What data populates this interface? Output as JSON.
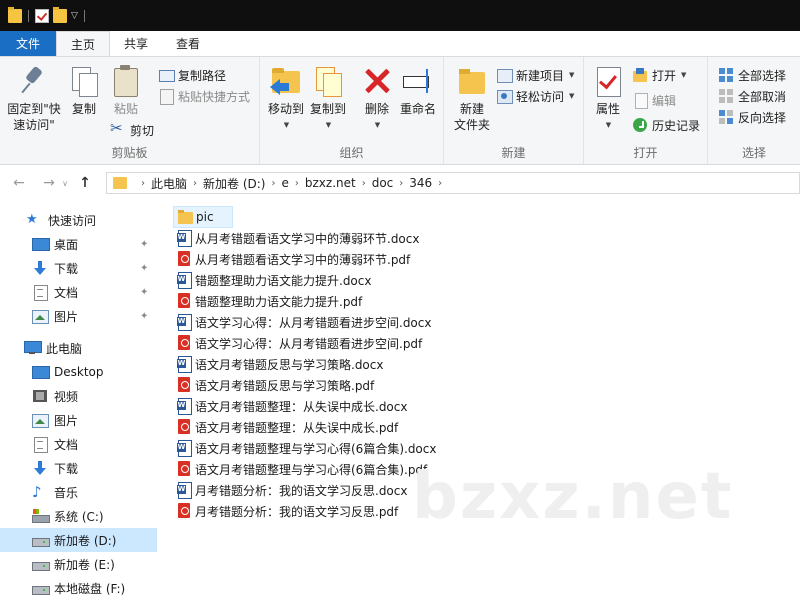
{
  "ribbon_tabs": [
    "文件",
    "主页",
    "共享",
    "查看"
  ],
  "clipboard": {
    "pin_label_1": "固定到\"快",
    "pin_label_2": "速访问\"",
    "copy": "复制",
    "paste": "粘贴",
    "copy_path": "复制路径",
    "paste_shortcut": "粘贴快捷方式",
    "cut": "剪切",
    "group": "剪贴板"
  },
  "organize": {
    "move_to": "移动到",
    "copy_to": "复制到",
    "delete": "删除",
    "rename": "重命名",
    "group": "组织"
  },
  "new": {
    "new_folder_1": "新建",
    "new_folder_2": "文件夹",
    "new_item": "新建项目",
    "easy_access": "轻松访问",
    "group": "新建"
  },
  "open": {
    "properties": "属性",
    "open": "打开",
    "edit": "编辑",
    "history": "历史记录",
    "group": "打开"
  },
  "select": {
    "select_all": "全部选择",
    "select_none": "全部取消",
    "invert": "反向选择",
    "group": "选择"
  },
  "address": {
    "segments": [
      "此电脑",
      "新加卷 (D:)",
      "e",
      "bzxz.net",
      "doc",
      "346"
    ]
  },
  "sidebar": {
    "items": [
      {
        "label": "快速访问",
        "icon": "star-icon"
      },
      {
        "label": "桌面",
        "icon": "desktop-icon",
        "pinned": true
      },
      {
        "label": "下载",
        "icon": "download-icon",
        "pinned": true
      },
      {
        "label": "文档",
        "icon": "document-icon",
        "pinned": true
      },
      {
        "label": "图片",
        "icon": "picture-icon",
        "pinned": true
      },
      {
        "label": "此电脑",
        "icon": "computer-icon"
      },
      {
        "label": "Desktop",
        "icon": "desktop-icon"
      },
      {
        "label": "视频",
        "icon": "video-icon"
      },
      {
        "label": "图片",
        "icon": "picture-icon"
      },
      {
        "label": "文档",
        "icon": "document-icon"
      },
      {
        "label": "下载",
        "icon": "download-icon"
      },
      {
        "label": "音乐",
        "icon": "music-icon"
      },
      {
        "label": "系统 (C:)",
        "icon": "system-drive-icon"
      },
      {
        "label": "新加卷 (D:)",
        "icon": "drive-icon",
        "selected": true
      },
      {
        "label": "新加卷 (E:)",
        "icon": "drive-icon"
      },
      {
        "label": "本地磁盘 (F:)",
        "icon": "drive-icon"
      }
    ]
  },
  "files": [
    {
      "name": "pic",
      "type": "folder"
    },
    {
      "name": "从月考错题看语文学习中的薄弱环节.docx",
      "type": "docx"
    },
    {
      "name": "从月考错题看语文学习中的薄弱环节.pdf",
      "type": "pdf"
    },
    {
      "name": "错题整理助力语文能力提升.docx",
      "type": "docx"
    },
    {
      "name": "错题整理助力语文能力提升.pdf",
      "type": "pdf"
    },
    {
      "name": "语文学习心得：从月考错题看进步空间.docx",
      "type": "docx"
    },
    {
      "name": "语文学习心得：从月考错题看进步空间.pdf",
      "type": "pdf"
    },
    {
      "name": "语文月考错题反思与学习策略.docx",
      "type": "docx"
    },
    {
      "name": "语文月考错题反思与学习策略.pdf",
      "type": "pdf"
    },
    {
      "name": "语文月考错题整理：从失误中成长.docx",
      "type": "docx"
    },
    {
      "name": "语文月考错题整理：从失误中成长.pdf",
      "type": "pdf"
    },
    {
      "name": "语文月考错题整理与学习心得(6篇合集).docx",
      "type": "docx"
    },
    {
      "name": "语文月考错题整理与学习心得(6篇合集).pdf",
      "type": "pdf"
    },
    {
      "name": "月考错题分析：我的语文学习反思.docx",
      "type": "docx"
    },
    {
      "name": "月考错题分析：我的语文学习反思.pdf",
      "type": "pdf"
    }
  ],
  "watermark": "bzxz.net",
  "colors": {
    "file_tab": "#1a6fc4",
    "selection": "#cce8ff",
    "folder": "#f4c44e",
    "pdf": "#d93025",
    "docx": "#2b579a"
  }
}
